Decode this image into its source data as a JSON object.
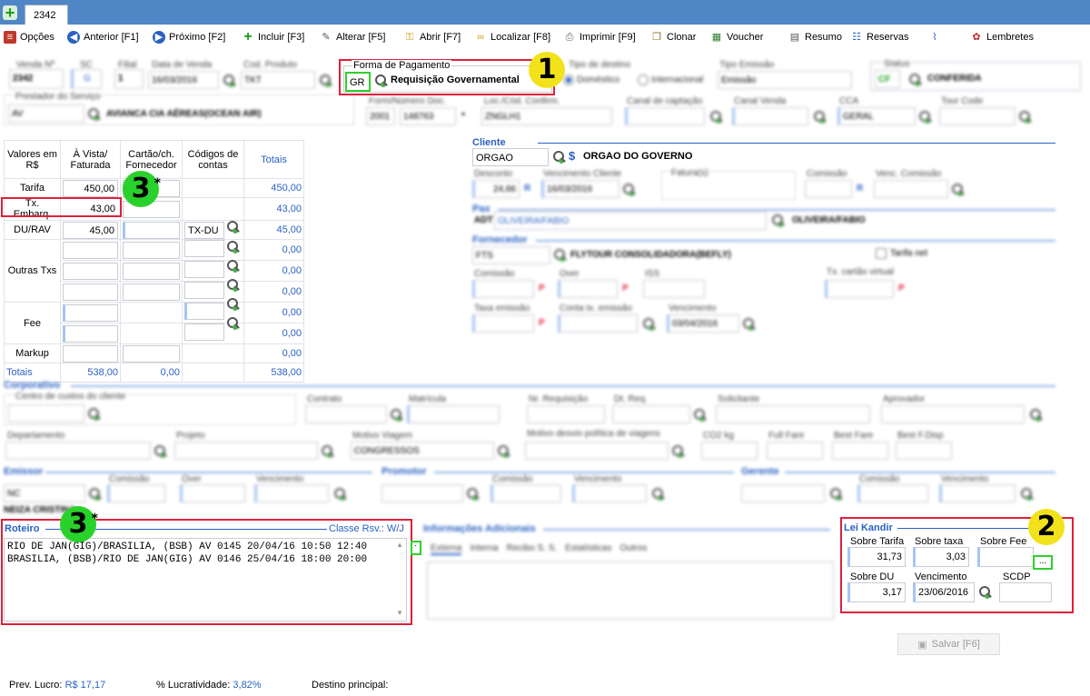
{
  "tab": {
    "label": "2342"
  },
  "toolbar": [
    {
      "label": "Opções"
    },
    {
      "label": "Anterior [F1]"
    },
    {
      "label": "Próximo [F2]"
    },
    {
      "label": "Incluir [F3]"
    },
    {
      "label": "Alterar [F5]"
    },
    {
      "label": "Abrir [F7]"
    },
    {
      "label": "Localizar [F8]"
    },
    {
      "label": "Imprimir [F9]"
    },
    {
      "label": "Clonar"
    },
    {
      "label": "Voucher"
    },
    {
      "label": "Resumo"
    },
    {
      "label": "Reservas"
    },
    {
      "label": "Lembretes"
    }
  ],
  "header": {
    "venda_label": "Venda Nº",
    "venda": "2342",
    "sc_label": "SC",
    "sc": "G",
    "filial_label": "Filial",
    "filial": "1",
    "data_label": "Data de Venda",
    "data": "16/03/2016",
    "cod_label": "Cod. Produto",
    "cod": "TKT",
    "forma_pag_label": "Forma de Pagamento",
    "forma_pag_code": "GR",
    "forma_pag_name": "Requisição Governamental",
    "tipo_destino_label": "Tipo de destino",
    "tipo_domestico": "Doméstico",
    "tipo_internacional": "Internacional",
    "tipo_emissao_label": "Tipo Emissão",
    "tipo_emissao": "Emissão",
    "status_label": "Status",
    "status_code": "CF",
    "status": "CONFERIDA",
    "prestador_label": "Prestador do Serviço",
    "prestador_code": "AV",
    "prestador": "AVIANCA CIA AÉREAS(OCEAN AIR)",
    "form_doc_label": "Form/Número Doc.",
    "form": "2001",
    "doc": "148763",
    "loc_label": "Loc./Cód. Confirm.",
    "loc": "ZNGLH1",
    "canal_cap_label": "Canal de captação",
    "canal_venda_label": "Canal Venda",
    "cca_label": "CCA",
    "cca": "GERAL",
    "tour_label": "Tour Code"
  },
  "values": {
    "col_head_1": "Valores em R$",
    "col_head_2": "À Vista/ Faturada",
    "col_head_3": "Cartão/ch. Fornecedor",
    "col_head_4": "Códigos de contas",
    "col_head_5": "Totais",
    "rows": [
      {
        "label": "Tarifa",
        "vista": "450,00",
        "total": "450,00"
      },
      {
        "label": "Tx. Embarq.",
        "vista": "43,00",
        "total": "43,00"
      },
      {
        "label": "DU/RAV",
        "vista": "45,00",
        "code": "TX-DU",
        "total": "45,00"
      },
      {
        "label": "Outras Txs",
        "total1": "0,00",
        "total2": "0,00",
        "total3": "0,00"
      },
      {
        "label": "Fee",
        "total1": "0,00",
        "total2": "0,00"
      },
      {
        "label": "Markup",
        "total": "0,00"
      }
    ],
    "totais_label": "Totais",
    "totais_vista": "538,00",
    "totais_cartao": "0,00",
    "totais_total": "538,00"
  },
  "cliente": {
    "title": "Cliente",
    "code": "ORGAO",
    "name": "ORGAO DO GOVERNO",
    "desconto_label": "Desconto",
    "desconto": "24,66",
    "venc_label": "Vencimento Cliente",
    "venc": "16/03/2016",
    "fatura_label": "Fatura(s)",
    "comissao_label": "Comissão",
    "venc_comissao_label": "Venc. Comissão"
  },
  "pax": {
    "title": "Pax",
    "type": "ADT",
    "name": "OLIVEIRA/FABIO",
    "name2": "OLIVEIRA/FABIO"
  },
  "fornecedor": {
    "title": "Fornecedor",
    "code": "FTS",
    "name": "FLYTOUR CONSOLIDADORA(BEFLY)",
    "tarifa_net": "Tarifa net",
    "comissao_label": "Comissão",
    "over_label": "Over",
    "iss_label": "ISS",
    "tx_cartao_label": "Tx. cartão virtual",
    "taxa_emissao_label": "Taxa emissão",
    "conta_tx_label": "Conta tx. emissão",
    "venc_label": "Vencimento",
    "venc": "03/04/2016"
  },
  "corporativo": {
    "title": "Corporativo",
    "centro_label": "Centro de custos do cliente",
    "contrato_label": "Contrato",
    "matricula_label": "Matrícula",
    "nr_req_label": "Nr. Requisição",
    "dt_req_label": "Dt. Req.",
    "solicitante_label": "Solicitante",
    "aprovador_label": "Aprovador",
    "depto_label": "Departamento",
    "projeto_label": "Projeto",
    "motivo_label": "Motivo Viagem",
    "motivo": "CONGRESSOS",
    "desvio_label": "Motivo desvio política de viagens",
    "co2_label": "CO2 kg",
    "full_label": "Full Fare",
    "best_label": "Best Fare",
    "bestf_label": "Best F.Disp"
  },
  "emissor": {
    "title": "Emissor",
    "code": "NC",
    "name": "NEIZA CRISTINA",
    "comissao_label": "Comissão",
    "over_label": "Over",
    "venc_label": "Vencimento"
  },
  "promotor": {
    "title": "Promotor",
    "comissao_label": "Comissão",
    "venc_label": "Vencimento"
  },
  "gerente": {
    "title": "Gerente",
    "comissao_label": "Comissão",
    "venc_label": "Vencimento"
  },
  "roteiro": {
    "title": "Roteiro",
    "classe": "Classe Rsv.: W/J",
    "line1": "RIO DE JAN(GIG)/BRASILIA, (BSB) AV 0145 20/04/16 10:50 12:40",
    "line2": "BRASILIA, (BSB)/RIO DE JAN(GIG) AV 0146 25/04/16 18:00 20:00"
  },
  "info": {
    "title": "Informações Adicionais",
    "tabs": [
      "Externa",
      "Interna",
      "Recibo S. S.",
      "Estatísticas",
      "Outros"
    ]
  },
  "lei": {
    "title": "Lei Kandir",
    "sobre_tarifa_label": "Sobre Tarifa",
    "sobre_tarifa": "31,73",
    "sobre_taxa_label": "Sobre taxa",
    "sobre_taxa": "3,03",
    "sobre_fee_label": "Sobre Fee",
    "sobre_fee_btn": "...",
    "sobre_du_label": "Sobre DU",
    "sobre_du": "3,17",
    "venc_label": "Vencimento",
    "venc": "23/06/2016",
    "scdp_label": "SCDP"
  },
  "salvar": "Salvar [F6]",
  "footer": {
    "prev_label": "Prev. Lucro:",
    "prev": "R$ 17,17",
    "lucr_label": "% Lucratividade:",
    "lucr": "3,82%",
    "destino_label": "Destino principal:"
  },
  "badges": {
    "b1": "1",
    "b2": "2",
    "b3": "3",
    "b3star": "*"
  },
  "colors": {
    "accent": "#2a62c2",
    "highlight_red": "#e0203a",
    "highlight_green": "#2fd02f",
    "badge_yellow": "#f2e21c",
    "badge_green": "#29d12b"
  }
}
